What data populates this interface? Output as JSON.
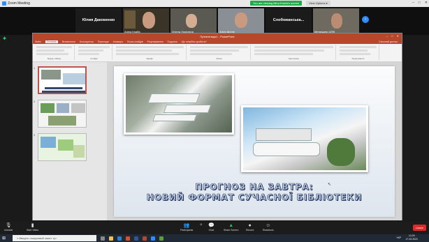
{
  "zoom": {
    "window_title": "Zoom Meeting",
    "share_banner": "You are viewing Alina Kravts's screen",
    "view_options": "View Options ▾"
  },
  "gallery": [
    {
      "name": "Юлия Дакоменко"
    },
    {
      "name": "Аліна Кпаба"
    },
    {
      "name": "Олена Лопатина"
    },
    {
      "name": "Алла Шелю"
    },
    {
      "name": "Слобожанська..."
    },
    {
      "name": "Менеджер ЦПВ"
    }
  ],
  "ppt": {
    "title": "Презентація1 - PowerPoint",
    "tabs": [
      "Файл",
      "Основне",
      "Вставлення",
      "Конструктор",
      "Переходи",
      "Анімація",
      "Показ слайдів",
      "Рецензування",
      "Подання",
      "Що потрібно зробити?"
    ],
    "active_tab": "Основне",
    "share_label": "Спільний доступ",
    "ribbon_groups": [
      "Буфер обміну",
      "Слайди",
      "Шрифт",
      "Абзац",
      "Креслення",
      "Редагування"
    ],
    "slide_numbers": [
      "1",
      "2",
      "3"
    ],
    "slide_title_line1": "ПРОГНОЗ НА ЗАВТРА:",
    "slide_title_line2": "НОВИЙ ФОРМАТ СУЧАСНОЇ БІБЛІОТЕКИ"
  },
  "toolbar": {
    "unmute": "Unmute",
    "start_video": "Start Video",
    "participants": "Participants",
    "participants_count": "11",
    "chat": "Chat",
    "share_screen": "Share Screen",
    "record": "Record",
    "reactions": "Reactions",
    "end": "Leave"
  },
  "taskbar": {
    "search_placeholder": "Введіть пошуковий запит тут",
    "lang": "УКР",
    "time": "13:29",
    "date": "17.03.2021"
  }
}
